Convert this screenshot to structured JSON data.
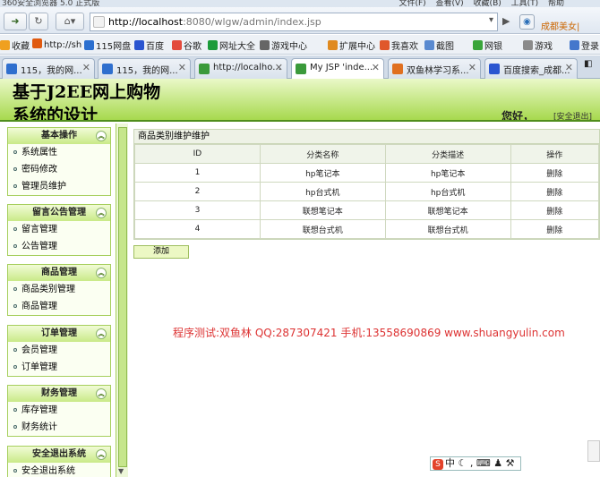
{
  "browser": {
    "title": "360安全浏览器 5.0 正式版",
    "menu": "文件(F)  查看(V)  收藏(B)  工具(T)  帮助",
    "url_host": "http://localhost",
    "url_rest": ":8080/wlgw/admin/index.jsp",
    "site_link": "成都美女|",
    "favorites": [
      {
        "label": "收藏",
        "color": "#f0a020"
      },
      {
        "label": "http://sh",
        "color": "#e05a10"
      },
      {
        "label": "115网盘",
        "color": "#2b6fcf"
      },
      {
        "label": "百度",
        "color": "#2a55d0"
      },
      {
        "label": "谷歌",
        "color": "#e34b3c"
      },
      {
        "label": "网址大全",
        "color": "#1c9b3a"
      },
      {
        "label": "游戏中心",
        "color": "#666666"
      },
      {
        "label": "扩展中心",
        "color": "#e08a20"
      },
      {
        "label": "我喜欢",
        "color": "#e0582b"
      },
      {
        "label": "截图",
        "color": "#5a8ad0"
      },
      {
        "label": "网银",
        "color": "#3aa53a"
      },
      {
        "label": "游戏",
        "color": "#8b8b8b"
      },
      {
        "label": "登录",
        "color": "#4477cc"
      }
    ],
    "tabs": [
      {
        "label": "115，我的网...",
        "icon": "#2f6fce"
      },
      {
        "label": "115，我的网...",
        "icon": "#2f6fce"
      },
      {
        "label": "http://localho...",
        "icon": "#3a9a3a"
      },
      {
        "label": "My JSP 'inde...",
        "icon": "#3a9a3a"
      },
      {
        "label": "双鱼林学习系...",
        "icon": "#e07020"
      },
      {
        "label": "百度搜索_成都...",
        "icon": "#2a55d0"
      }
    ]
  },
  "header": {
    "title": "基于J2EE网上购物系统的设计",
    "greeting": "您好，",
    "logout": "[安全退出]"
  },
  "sidebar": [
    {
      "title": "基本操作",
      "items": [
        "系统属性",
        "密码修改",
        "管理员维护"
      ]
    },
    {
      "title": "留言公告管理",
      "items": [
        "留言管理",
        "公告管理"
      ]
    },
    {
      "title": "商品管理",
      "items": [
        "商品类别管理",
        "商品管理"
      ]
    },
    {
      "title": "订单管理",
      "items": [
        "会员管理",
        "订单管理"
      ]
    },
    {
      "title": "财务管理",
      "items": [
        "库存管理",
        "财务统计"
      ]
    },
    {
      "title": "安全退出系统",
      "items": [
        "安全退出系统"
      ]
    }
  ],
  "main": {
    "title": "商品类别维护维护",
    "columns": [
      "ID",
      "分类名称",
      "分类描述",
      "操作"
    ],
    "rows": [
      [
        "1",
        "hp笔记本",
        "hp笔记本",
        "删除"
      ],
      [
        "2",
        "hp台式机",
        "hp台式机",
        "删除"
      ],
      [
        "3",
        "联想笔记本",
        "联想笔记本",
        "删除"
      ],
      [
        "4",
        "联想台式机",
        "联想台式机",
        "删除"
      ]
    ],
    "add_label": "添加",
    "note": "程序测试:双鱼林 QQ:287307421 手机:13558690869 www.shuangyulin.com"
  },
  "ime": {
    "label": "中"
  }
}
